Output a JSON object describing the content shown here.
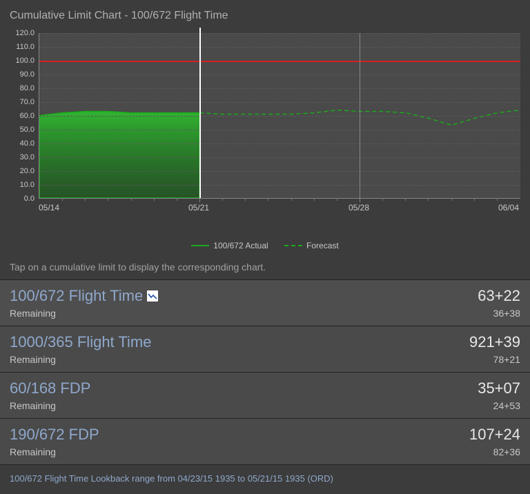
{
  "header": {
    "title": "Cumulative Limit Chart - 100/672 Flight Time"
  },
  "chart_data": {
    "type": "area",
    "title": "Cumulative Limit Chart - 100/672 Flight Time",
    "xlabel": "",
    "ylabel": "",
    "ylim": [
      0,
      120
    ],
    "y_ticks": [
      "0.0",
      "10.0",
      "20.0",
      "30.0",
      "40.0",
      "50.0",
      "60.0",
      "70.0",
      "80.0",
      "90.0",
      "100.0",
      "110.0",
      "120.0"
    ],
    "x_ticks": [
      "05/14",
      "05/21",
      "05/28",
      "06/04"
    ],
    "limit_y": 100.0,
    "today_x": "05/21",
    "series": [
      {
        "name": "100/672 Actual",
        "style": "solid-area",
        "color": "#1aab1a",
        "x": [
          "05/14",
          "05/15",
          "05/16",
          "05/17",
          "05/18",
          "05/19",
          "05/20",
          "05/21"
        ],
        "values": [
          60,
          62,
          63,
          63,
          62,
          62,
          62,
          62
        ]
      },
      {
        "name": "Forecast",
        "style": "dashed",
        "color": "#1aab1a",
        "x": [
          "05/21",
          "05/22",
          "05/23",
          "05/24",
          "05/25",
          "05/26",
          "05/27",
          "05/28",
          "05/29",
          "05/30",
          "05/31",
          "06/01",
          "06/02",
          "06/03",
          "06/04"
        ],
        "values": [
          62,
          61,
          61,
          61,
          61,
          62,
          64,
          63,
          63,
          62,
          58,
          53,
          58,
          62,
          64
        ]
      }
    ],
    "legend": [
      "100/672 Actual",
      "Forecast"
    ]
  },
  "hint": "Tap on a cumulative limit to display the corresponding chart.",
  "limits": [
    {
      "title": "100/672 Flight Time",
      "selected": true,
      "value": "63+22",
      "remaining_label": "Remaining",
      "remaining_value": "36+38"
    },
    {
      "title": "1000/365 Flight Time",
      "selected": false,
      "value": "921+39",
      "remaining_label": "Remaining",
      "remaining_value": "78+21"
    },
    {
      "title": "60/168 FDP",
      "selected": false,
      "value": "35+07",
      "remaining_label": "Remaining",
      "remaining_value": "24+53"
    },
    {
      "title": "190/672 FDP",
      "selected": false,
      "value": "107+24",
      "remaining_label": "Remaining",
      "remaining_value": "82+36"
    }
  ],
  "footer": "100/672 Flight Time Lookback range from 04/23/15 1935 to 05/21/15 1935 (ORD)"
}
